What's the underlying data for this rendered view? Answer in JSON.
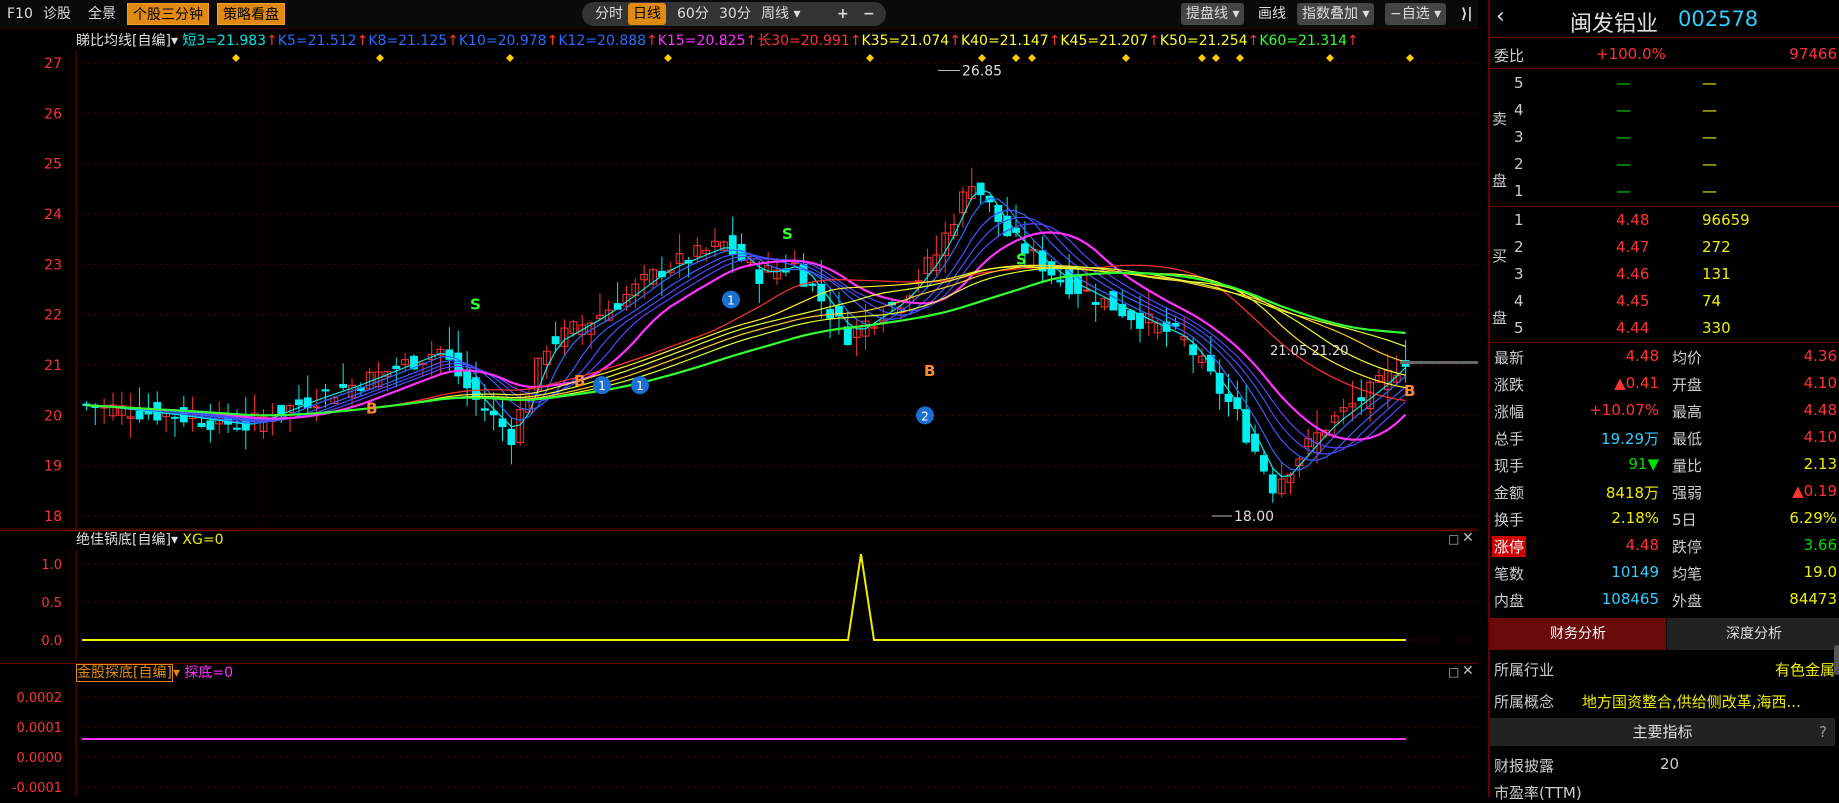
{
  "toolbar": {
    "f10": "F10",
    "diag": "诊股",
    "full": "全景",
    "stock3": "个股三分钟",
    "strategy": "策略看盘",
    "fenshi": "分时",
    "rixian": "日线",
    "m60": "60分",
    "m30": "30分",
    "zhouxian": "周线",
    "plus": "+",
    "minus": "−",
    "tipan": "提盘线",
    "huaxian": "画线",
    "zhishu": "指数叠加",
    "zixuan": "自选"
  },
  "ma_header": {
    "name": "睇比均线[自编]",
    "items": [
      {
        "text": "短3=21.983",
        "color": "#00e5e5"
      },
      {
        "text": "K5=21.512",
        "color": "#2a6cff"
      },
      {
        "text": "K8=21.125",
        "color": "#2a6cff"
      },
      {
        "text": "K10=20.978",
        "color": "#2a6cff"
      },
      {
        "text": "K12=20.888",
        "color": "#2a6cff"
      },
      {
        "text": "K15=20.825",
        "color": "#ff33ff"
      },
      {
        "text": "长30=20.991",
        "color": "#ff3333"
      },
      {
        "text": "K35=21.074",
        "color": "#ffff33"
      },
      {
        "text": "K40=21.147",
        "color": "#ffff33"
      },
      {
        "text": "K45=21.207",
        "color": "#ffff33"
      },
      {
        "text": "K50=21.254",
        "color": "#ffff33"
      },
      {
        "text": "K60=21.314",
        "color": "#33ff33"
      }
    ]
  },
  "chart_data": {
    "type": "candlestick",
    "y_ticks": [
      "27",
      "26",
      "25",
      "24",
      "23",
      "22",
      "21",
      "20",
      "19",
      "18"
    ],
    "ylim": [
      18,
      27
    ],
    "high_label": "26.85",
    "low_label": "18.00",
    "ma_label": "21.05 21.20",
    "markers": {
      "buy": "B",
      "sell": "S",
      "n1": "1",
      "n2": "2"
    },
    "indicator1": {
      "name": "绝佳锅底[自编]",
      "value": "XG=0",
      "ticks": [
        "1.0",
        "0.5",
        "0.0"
      ]
    },
    "indicator2": {
      "name": "金股探底[自编]",
      "value": "探底=0",
      "ticks": [
        "0.0002",
        "0.0001",
        "0.0000",
        "-0.0001"
      ]
    }
  },
  "quote": {
    "name": "闽发铝业",
    "code": "002578",
    "weibi_label": "委比",
    "weibi": "+100.0%",
    "weicha": "97466",
    "sell": [
      {
        "n": "5",
        "p": "—",
        "v": "—"
      },
      {
        "n": "4",
        "p": "—",
        "v": "—"
      },
      {
        "n": "3",
        "p": "—",
        "v": "—"
      },
      {
        "n": "2",
        "p": "—",
        "v": "—"
      },
      {
        "n": "1",
        "p": "—",
        "v": "—"
      }
    ],
    "buy": [
      {
        "n": "1",
        "p": "4.48",
        "v": "96659"
      },
      {
        "n": "2",
        "p": "4.47",
        "v": "272"
      },
      {
        "n": "3",
        "p": "4.46",
        "v": "131"
      },
      {
        "n": "4",
        "p": "4.45",
        "v": "74"
      },
      {
        "n": "5",
        "p": "4.44",
        "v": "330"
      }
    ],
    "sell_side": "卖盘",
    "buy_side": "买盘",
    "stats": [
      {
        "l1": "最新",
        "v1": "4.48",
        "c1": "red",
        "l2": "均价",
        "v2": "4.36",
        "c2": "red"
      },
      {
        "l1": "涨跌",
        "v1": "▲0.41",
        "c1": "red",
        "l2": "开盘",
        "v2": "4.10",
        "c2": "red"
      },
      {
        "l1": "涨幅",
        "v1": "+10.07%",
        "c1": "red",
        "l2": "最高",
        "v2": "4.48",
        "c2": "red"
      },
      {
        "l1": "总手",
        "v1": "19.29万",
        "c1": "cyan",
        "l2": "最低",
        "v2": "4.10",
        "c2": "red"
      },
      {
        "l1": "现手",
        "v1": "91▼",
        "c1": "grn",
        "l2": "量比",
        "v2": "2.13",
        "c2": "yel"
      },
      {
        "l1": "金额",
        "v1": "8418万",
        "c1": "yel",
        "l2": "强弱",
        "v2": "▲0.19",
        "c2": "red"
      },
      {
        "l1": "换手",
        "v1": "2.18%",
        "c1": "yel",
        "l2": "5日",
        "v2": "6.29%",
        "c2": "yel"
      },
      {
        "l1": "涨停",
        "v1": "4.48",
        "c1": "red",
        "l2": "跌停",
        "v2": "3.66",
        "c2": "grn"
      },
      {
        "l1": "笔数",
        "v1": "10149",
        "c1": "cyan",
        "l2": "均笔",
        "v2": "19.0",
        "c2": "yel"
      },
      {
        "l1": "内盘",
        "v1": "108465",
        "c1": "cyan",
        "l2": "外盘",
        "v2": "84473",
        "c2": "yel"
      }
    ],
    "tab1": "财务分析",
    "tab2": "深度分析",
    "industry_label": "所属行业",
    "industry": "有色金属",
    "concept_label": "所属概念",
    "concept": "地方国资整合,供给侧改革,海西...",
    "main_ind": "主要指标",
    "disclose": "财报披露",
    "disclose_val": "20",
    "pe": "市盈率(TTM)"
  }
}
